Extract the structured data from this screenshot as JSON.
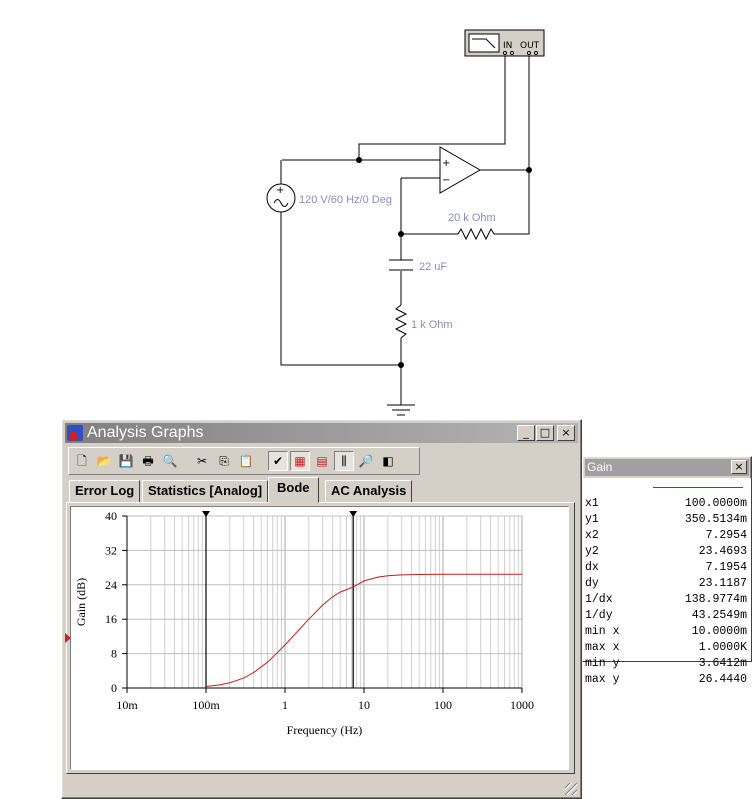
{
  "schematic": {
    "bode_plotter": {
      "in_label": "IN",
      "out_label": "OUT"
    },
    "source_label": "120 V/60 Hz/0 Deg",
    "r_feedback_label": "20 k Ohm",
    "capacitor_label": "22 uF",
    "r_ground_label": "1 k Ohm",
    "opamp_plus": "+",
    "opamp_minus": "−"
  },
  "window": {
    "title": "Analysis Graphs",
    "minimize": "_",
    "maximize": "□",
    "close": "×"
  },
  "toolbar": {
    "icons": [
      "new-icon",
      "open-icon",
      "save-icon",
      "print-icon",
      "print-preview-icon",
      "cut-icon",
      "copy-icon",
      "paste-icon",
      "toggle-grid-icon",
      "grid-icon",
      "legend-icon",
      "cursors-icon",
      "zoom-icon",
      "reverse-colors-icon"
    ],
    "glyphs": [
      "🗋",
      "📂",
      "💾",
      "🖶",
      "🔍",
      "✂",
      "⎘",
      "📋",
      "✔",
      "▦",
      "▤",
      "⫼",
      "🔎",
      "◧"
    ]
  },
  "tabs": [
    {
      "label": "Error Log"
    },
    {
      "label": "Statistics [Analog]"
    },
    {
      "label": "Bode"
    },
    {
      "label": "AC Analysis"
    }
  ],
  "active_tab": "Bode",
  "chart_data": {
    "type": "line",
    "xlabel": "Frequency (Hz)",
    "ylabel": "Gain (dB)",
    "x_scale": "log",
    "xlim": [
      0.01,
      1000
    ],
    "ylim": [
      0,
      40
    ],
    "x_ticks": [
      0.01,
      0.1,
      1,
      10,
      100,
      1000
    ],
    "x_tick_labels": [
      "10m",
      "100m",
      "1",
      "10",
      "100",
      "1000"
    ],
    "y_ticks": [
      0,
      8,
      16,
      24,
      32,
      40
    ],
    "y_tick_labels": [
      "0",
      "8",
      "16",
      "24",
      "32",
      "40"
    ],
    "grid": true,
    "series": [
      {
        "color": "#c02020",
        "x": [
          0.1,
          0.15,
          0.2,
          0.3,
          0.4,
          0.6,
          0.8,
          1,
          1.5,
          2,
          3,
          4,
          5,
          7.3,
          10,
          15,
          20,
          30,
          50,
          100,
          1000
        ],
        "y": [
          0.35,
          0.72,
          1.2,
          2.3,
          3.6,
          6.0,
          8.2,
          10.0,
          13.5,
          16.0,
          19.3,
          21.2,
          22.3,
          23.5,
          24.9,
          25.8,
          26.1,
          26.3,
          26.4,
          26.44,
          26.44
        ]
      }
    ],
    "cursors": [
      {
        "x": 0.1
      },
      {
        "x": 7.3
      }
    ]
  },
  "gain_panel": {
    "title": "Gain",
    "close": "×",
    "line_color": "#c02020",
    "rows": [
      {
        "key": "x1",
        "value": "100.0000m"
      },
      {
        "key": "y1",
        "value": "350.5134m"
      },
      {
        "key": "x2",
        "value": "7.2954"
      },
      {
        "key": "y2",
        "value": "23.4693"
      },
      {
        "key": "dx",
        "value": "7.1954"
      },
      {
        "key": "dy",
        "value": "23.1187"
      },
      {
        "key": "1/dx",
        "value": "138.9774m"
      },
      {
        "key": "1/dy",
        "value": "43.2549m"
      },
      {
        "key": "min x",
        "value": "10.0000m"
      },
      {
        "key": "max x",
        "value": "1.0000K"
      },
      {
        "key": "min y",
        "value": "3.6412m"
      },
      {
        "key": "max y",
        "value": "26.4440"
      }
    ]
  }
}
